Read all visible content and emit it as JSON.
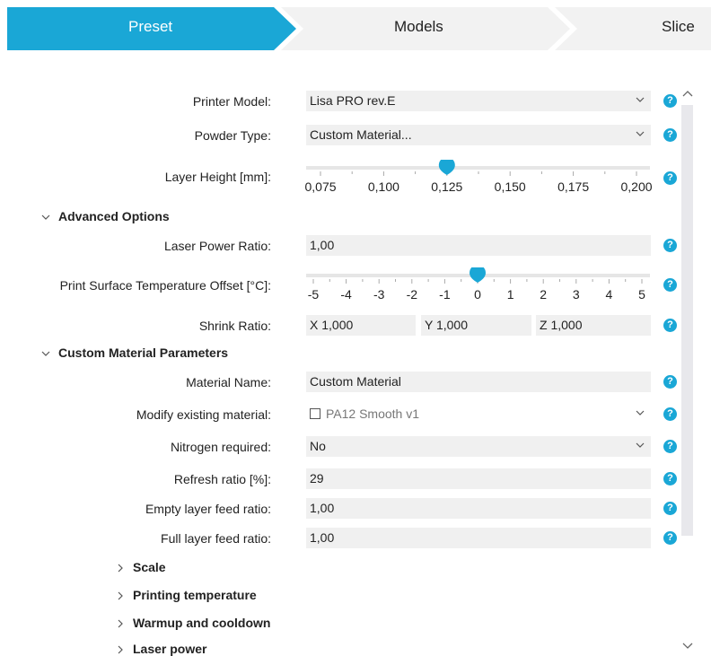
{
  "tabs": [
    {
      "label": "Preset",
      "active": true
    },
    {
      "label": "Models",
      "active": false
    },
    {
      "label": "Slice",
      "active": false
    }
  ],
  "colors": {
    "accent": "#1aa7d6",
    "tab_inactive": "#f2f2f2",
    "field_bg": "#f0f0f0"
  },
  "form": {
    "printer_model": {
      "label": "Printer Model:",
      "value": "Lisa PRO rev.E"
    },
    "powder_type": {
      "label": "Powder Type:",
      "value": "Custom Material..."
    },
    "layer_height": {
      "label": "Layer Height [mm]:",
      "ticks": [
        "0,075",
        "0,100",
        "0,125",
        "0,150",
        "0,175",
        "0,200"
      ],
      "value": "0,125"
    },
    "advanced": {
      "title": "Advanced Options",
      "laser_power_ratio": {
        "label": "Laser Power Ratio:",
        "value": "1,00"
      },
      "temp_offset": {
        "label": "Print Surface Temperature Offset [°C]:",
        "ticks": [
          "-5",
          "-4",
          "-3",
          "-2",
          "-1",
          "0",
          "1",
          "2",
          "3",
          "4",
          "5"
        ],
        "value": "0"
      },
      "shrink_ratio": {
        "label": "Shrink Ratio:",
        "x": "X 1,000",
        "y": "Y 1,000",
        "z": "Z 1,000"
      }
    },
    "custom": {
      "title": "Custom Material Parameters",
      "material_name": {
        "label": "Material Name:",
        "value": "Custom Material"
      },
      "modify_existing": {
        "label": "Modify existing material:",
        "value": "PA12 Smooth v1",
        "checked": false
      },
      "nitrogen": {
        "label": "Nitrogen required:",
        "value": "No"
      },
      "refresh_ratio": {
        "label": "Refresh ratio [%]:",
        "value": "29"
      },
      "empty_feed": {
        "label": "Empty layer feed ratio:",
        "value": "1,00"
      },
      "full_feed": {
        "label": "Full layer feed ratio:",
        "value": "1,00"
      },
      "subsections": [
        "Scale",
        "Printing temperature",
        "Warmup and cooldown",
        "Laser power"
      ]
    },
    "help_glyph": "?"
  }
}
